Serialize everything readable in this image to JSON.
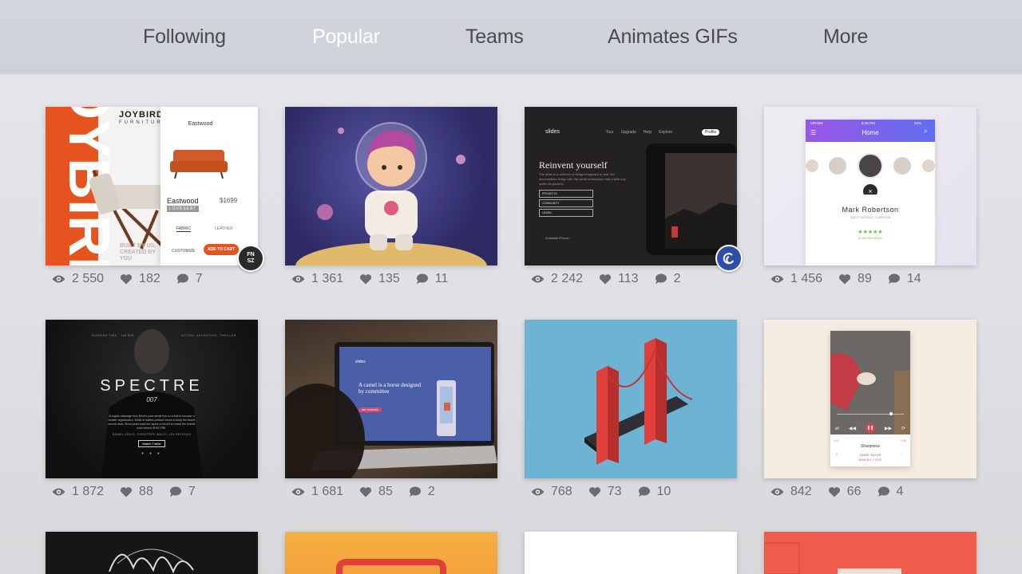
{
  "nav": {
    "items": [
      {
        "label": "Following",
        "active": false
      },
      {
        "label": "Popular",
        "active": true
      },
      {
        "label": "Teams",
        "active": false
      },
      {
        "label": "Animates GIFs",
        "active": false
      },
      {
        "label": "More",
        "active": false
      }
    ]
  },
  "colors": {
    "nav_active": "#ffffff",
    "nav_inactive": "#4a4a4f",
    "stats_text": "#6b6b70"
  },
  "shots": [
    {
      "views": "2 550",
      "likes": "182",
      "comments": "7",
      "badge": "fnsz",
      "content": {
        "brand": "JOYBIRD",
        "brand_sub": "FURNITURE",
        "product": "Eastwood",
        "price": "$1699",
        "tag": "LOVESEAT",
        "opt1": "FABRIC",
        "opt2": "LEATHER",
        "customize": "CUSTOMIZE",
        "cta": "ADD TO CART",
        "footer": "BUILT BY US, CREATED BY YOU",
        "big_text": "OYBIRD",
        "header": "Eastwood",
        "badge_text": "FN SZ"
      }
    },
    {
      "views": "1 361",
      "likes": "135",
      "comments": "11"
    },
    {
      "views": "2 242",
      "likes": "113",
      "comments": "2",
      "badge": "swirl",
      "content": {
        "logo": "slides",
        "menu": [
          "Tour",
          "Upgrade",
          "Help",
          "Explore"
        ],
        "profile": "Profile",
        "headline": "Reinvent yourself",
        "body": "The artist is a collector of things imaginary or real. He accumulates things with the same enthusiasm that a little boy stuffs his pockets.",
        "buttons": [
          "PROJECTS",
          "COMMUNITY",
          "LEARN"
        ],
        "footer": "Available iPhone"
      }
    },
    {
      "views": "1 456",
      "likes": "89",
      "comments": "14",
      "content": {
        "carrier": "VIRGIN",
        "time": "8:46 PM",
        "battery": "22%",
        "title": "Home",
        "name": "Mark Robertson",
        "location": "San Francisco, California",
        "reviews": "8,345 REVIEWS"
      }
    },
    {
      "views": "1 872",
      "likes": "88",
      "comments": "7",
      "content": {
        "top_left": "RUNNING TIME · 148 MIN",
        "top_right": "ACTION, ADVENTURE, THRILLER",
        "title": "SPECTRE",
        "subtitle": "007",
        "synopsis": "A cryptic message from Bond's past sends him on a trail to uncover a sinister organization. While M battles political forces to keep the secret service alive, Bond peels back the layers of deceit to reveal the terrible truth behind SPECTRE.",
        "cast": "DANIEL CRAIG, CHRISTOPH WALTZ, LÉA SEYDOUX",
        "cta": "Watch Trailer"
      }
    },
    {
      "views": "1 681",
      "likes": "85",
      "comments": "2",
      "content": {
        "logo": "slides",
        "headline": "A camel is a horse designed by committee",
        "cta": "GET STARTED"
      }
    },
    {
      "views": "768",
      "likes": "73",
      "comments": "10"
    },
    {
      "views": "842",
      "likes": "66",
      "comments": "4",
      "content": {
        "track": "Sharpness",
        "artist": "JAMIE MOON",
        "album": "MAKING LOVE",
        "t_start": "0:41",
        "t_end": "2:48"
      }
    }
  ]
}
